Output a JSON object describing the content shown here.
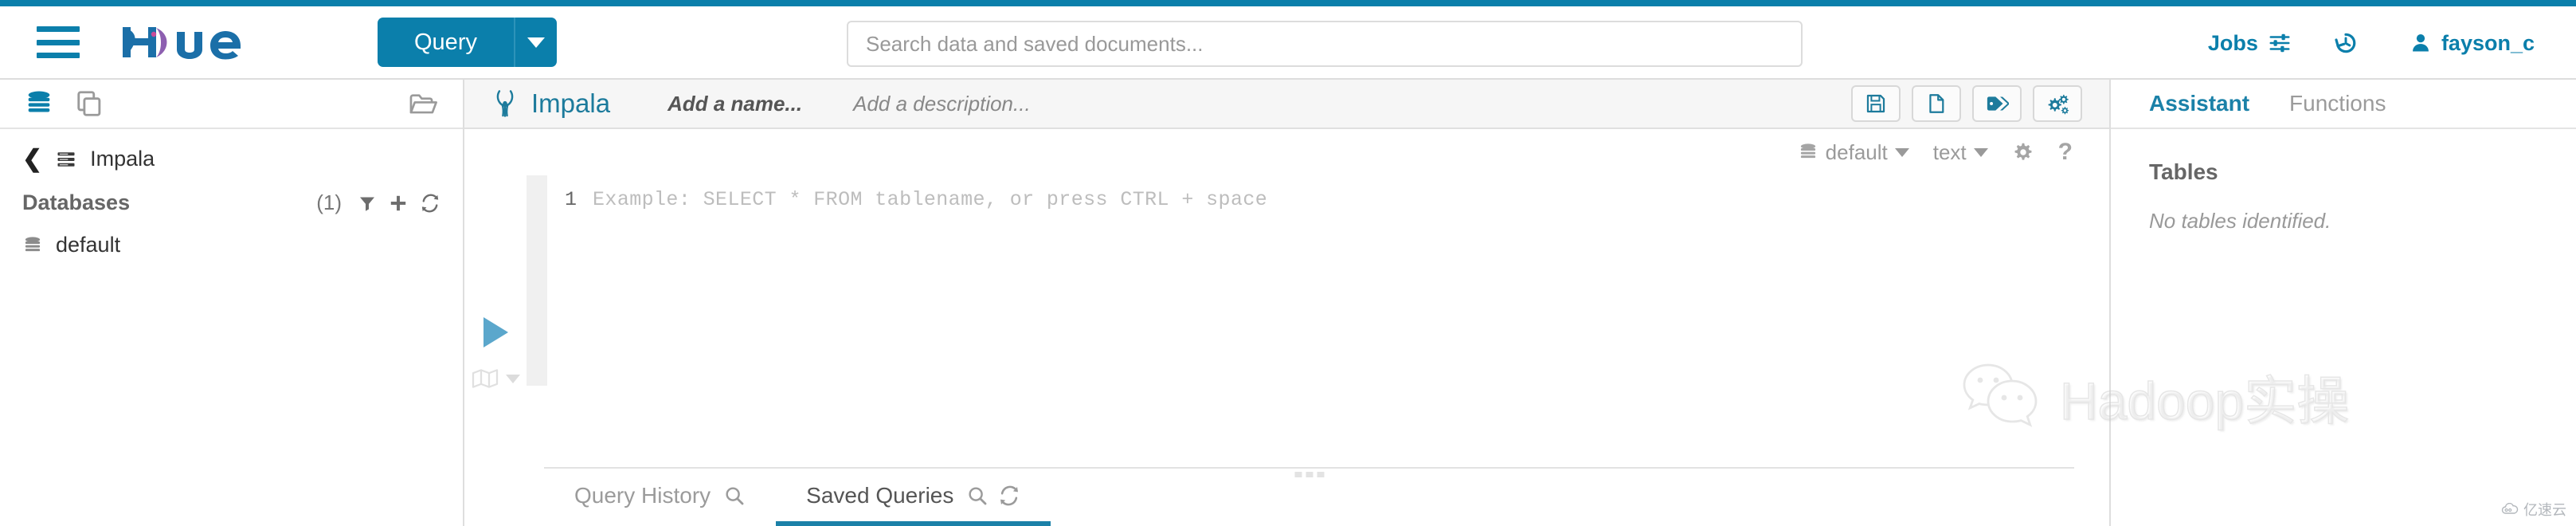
{
  "theme": {
    "accent": "#0b7fab",
    "accent_dark": "#1b81a8",
    "logo_blue": "#1b6fa8",
    "logo_purple": "#8d5fb0",
    "impala_teal": "#1d7b9c",
    "run_blue": "#5ba7cc",
    "muted_text": "#9b9b9b"
  },
  "navbar": {
    "menu_icon": "hamburger-icon",
    "logo_text": "hue",
    "query_button": {
      "label": "Query",
      "caret_icon": "chevron-down-icon"
    },
    "search": {
      "placeholder": "Search data and saved documents...",
      "value": ""
    },
    "right_items": [
      {
        "label": "Jobs",
        "icon": "sliders-icon"
      },
      {
        "label": "",
        "icon": "history-icon"
      },
      {
        "label": "fayson_c",
        "icon": "user-icon"
      }
    ]
  },
  "sidebar": {
    "head_icons": [
      {
        "name": "database-icon",
        "active": true
      },
      {
        "name": "documents-icon",
        "active": false
      },
      {
        "name": "open-folder-icon",
        "active": false
      }
    ],
    "breadcrumb": {
      "back_icon": "chevron-left-icon",
      "source_icon": "server-icon",
      "label": "Impala"
    },
    "databases_section": {
      "label": "Databases",
      "count": "(1)",
      "actions": [
        {
          "name": "filter-icon"
        },
        {
          "name": "plus-icon"
        },
        {
          "name": "refresh-icon"
        }
      ]
    },
    "databases": [
      {
        "icon": "database-icon",
        "label": "default"
      }
    ]
  },
  "editor": {
    "header": {
      "app_icon": "impala-logo-icon",
      "app_name": "Impala",
      "name_placeholder": "Add a name...",
      "description_placeholder": "Add a description...",
      "actions": [
        {
          "name": "save-icon",
          "label": "Save"
        },
        {
          "name": "new-document-icon",
          "label": "New"
        },
        {
          "name": "tag-icon",
          "label": "Tags"
        },
        {
          "name": "settings-gears-icon",
          "label": "Settings"
        }
      ]
    },
    "subbar": {
      "database": {
        "icon": "database-icon",
        "label": "default",
        "caret": "chevron-down-icon"
      },
      "result_format": {
        "label": "text",
        "caret": "chevron-down-icon"
      },
      "settings_icon": "gear-icon",
      "help_icon": "question-mark-icon"
    },
    "gutter": {
      "run_icon": "play-icon",
      "chart_icon": "map-chart-icon",
      "chart_caret": "chevron-down-icon"
    },
    "code": {
      "line_number": "1",
      "placeholder": "Example: SELECT * FROM tablename, or press CTRL + space"
    },
    "resize_handle": "drag-handle-dots"
  },
  "bottom_tabs": [
    {
      "label": "Query History",
      "active": false,
      "icons": [
        {
          "name": "search-icon"
        }
      ]
    },
    {
      "label": "Saved Queries",
      "active": true,
      "icons": [
        {
          "name": "search-icon"
        },
        {
          "name": "refresh-icon"
        }
      ]
    }
  ],
  "right_panel": {
    "tabs": [
      {
        "label": "Assistant",
        "active": true
      },
      {
        "label": "Functions",
        "active": false
      }
    ],
    "section_title": "Tables",
    "empty_message": "No tables identified."
  },
  "watermark": {
    "icon": "wechat-bubbles-icon",
    "text": "Hadoop实操"
  },
  "brandmark": {
    "icon": "cloud-icon",
    "text": "亿速云"
  }
}
